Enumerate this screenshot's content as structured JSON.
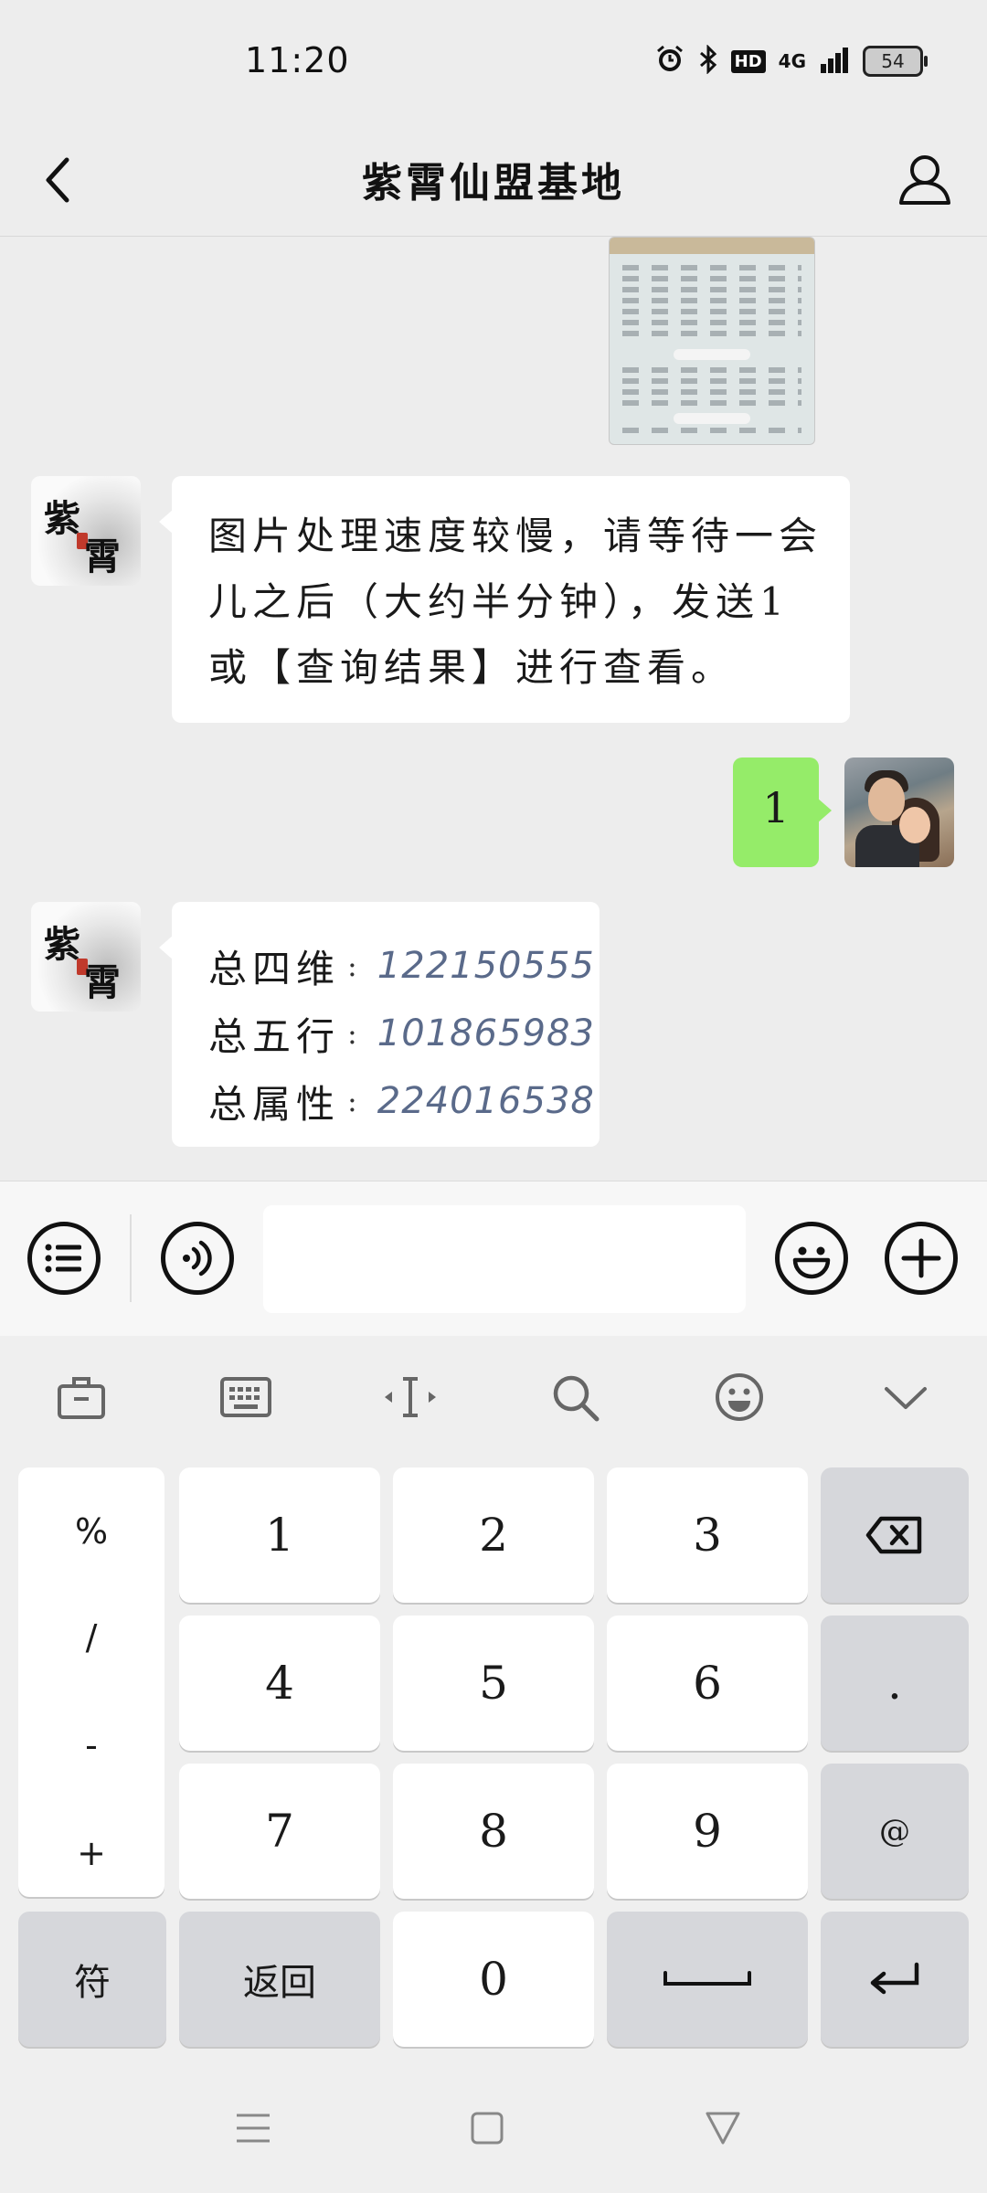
{
  "status_bar": {
    "time": "11:20",
    "hd": "HD",
    "network": "4G",
    "battery": "54",
    "icons": [
      "alarm-icon",
      "bluetooth-icon",
      "signal-icon"
    ]
  },
  "header": {
    "title": "紫霄仙盟基地",
    "back_icon": "chevron-left-icon",
    "profile_icon": "person-icon"
  },
  "messages": [
    {
      "side": "right",
      "type": "image"
    },
    {
      "side": "left",
      "type": "text",
      "text": "图片处理速度较慢，请等待一会儿之后（大约半分钟），发送1或【查询结果】进行查看。"
    },
    {
      "side": "right",
      "type": "text",
      "text": "1"
    },
    {
      "side": "left",
      "type": "stats",
      "rows": [
        {
          "label": "总四维",
          "sep": ":",
          "value": "122150555"
        },
        {
          "label": "总五行",
          "sep": ":",
          "value": "101865983"
        },
        {
          "label": "总属性",
          "sep": ":",
          "value": "224016538"
        }
      ]
    }
  ],
  "avatars": {
    "group_chars": [
      "紫",
      "霄"
    ]
  },
  "input_bar": {
    "value": "",
    "placeholder": ""
  },
  "keyboard": {
    "symbols": [
      "%",
      "/",
      "-",
      "+"
    ],
    "digits": [
      "1",
      "2",
      "3",
      "4",
      "5",
      "6",
      "7",
      "8",
      "9",
      "0"
    ],
    "dot": ".",
    "at": "@",
    "fu": "符",
    "back": "返回"
  }
}
